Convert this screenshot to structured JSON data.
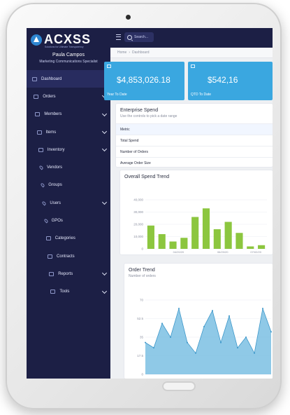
{
  "brand": {
    "name": "ACXSS",
    "tagline": "Solutions for Ultimate Transparency"
  },
  "topbar": {
    "search_placeholder": "Search..."
  },
  "user": {
    "name": "Paula Campos",
    "role": "Marketing Communications Specialist"
  },
  "nav": [
    {
      "label": "Dashboard",
      "icon": "monitor-icon",
      "caret": false,
      "active": true,
      "indent": 0
    },
    {
      "label": "Orders",
      "icon": "document-icon",
      "caret": true,
      "active": false,
      "indent": 1
    },
    {
      "label": "Members",
      "icon": "document-icon",
      "caret": true,
      "active": false,
      "indent": 2
    },
    {
      "label": "Items",
      "icon": "cube-icon",
      "caret": true,
      "active": false,
      "indent": 3
    },
    {
      "label": "Inventory",
      "icon": "cube-icon",
      "caret": true,
      "active": false,
      "indent": 4
    },
    {
      "label": "Vendors",
      "icon": "pin-icon",
      "caret": false,
      "active": false,
      "indent": 5
    },
    {
      "label": "Groups",
      "icon": "pin-icon",
      "caret": false,
      "active": false,
      "indent": 6
    },
    {
      "label": "Users",
      "icon": "pin-icon",
      "caret": true,
      "active": false,
      "indent": 7
    },
    {
      "label": "GPOs",
      "icon": "pin-icon",
      "caret": false,
      "active": false,
      "indent": 8
    },
    {
      "label": "Categories",
      "icon": "document-icon",
      "caret": false,
      "active": false,
      "indent": 9
    },
    {
      "label": "Contracts",
      "icon": "document-icon",
      "caret": false,
      "active": false,
      "indent": 10
    },
    {
      "label": "Reports",
      "icon": "document-icon",
      "caret": true,
      "active": false,
      "indent": 11
    },
    {
      "label": "Tools",
      "icon": "document-icon",
      "caret": true,
      "active": false,
      "indent": 12
    }
  ],
  "breadcrumb": {
    "home": "Home",
    "current": "Dashboard"
  },
  "tiles": [
    {
      "value": "$4,853,026.18",
      "label": "Year To Date",
      "icon": "tablet-icon"
    },
    {
      "value": "$542,16",
      "label": "QTD To Date",
      "icon": "image-icon"
    }
  ],
  "enterprise": {
    "title": "Enterprise Spend",
    "subtitle": "Use the controls to pick a date range",
    "rows": [
      "Metric",
      "Total Spend",
      "Number of Orders",
      "Average Order Size"
    ]
  },
  "colors": {
    "sidebar": "#1c1f45",
    "accent": "#3aa7e0",
    "bars": "#8cc63f",
    "area": "#6ab7df"
  },
  "chart_data": [
    {
      "type": "bar",
      "title": "Overall Spend Trend",
      "yticks": [
        "40,000",
        "30,000",
        "20,000",
        "10,000",
        "0"
      ],
      "xticks": [
        "04/20/20",
        "06/20/20",
        "07/02/20"
      ],
      "ylim": [
        0,
        40000
      ],
      "values": [
        19000,
        12000,
        6000,
        9000,
        26000,
        33000,
        16000,
        22000,
        13000,
        2000,
        3000
      ]
    },
    {
      "type": "area",
      "title": "Order Trend",
      "subtitle": "Number of orders",
      "yticks": [
        "70",
        "52.5",
        "35",
        "17.5",
        "0"
      ],
      "ylim": [
        0,
        70
      ],
      "values": [
        30,
        25,
        48,
        35,
        62,
        30,
        20,
        45,
        60,
        30,
        55,
        25,
        35,
        20,
        62,
        40
      ]
    }
  ]
}
